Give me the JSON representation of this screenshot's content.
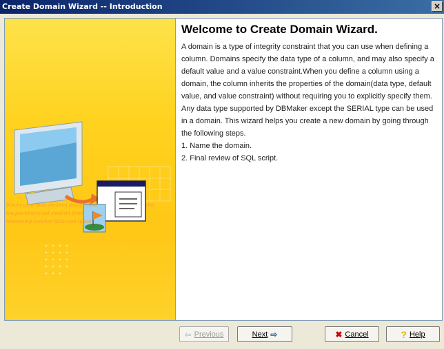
{
  "window": {
    "title": "Create Domain Wizard -- Introduction",
    "close_label": "×"
  },
  "content": {
    "heading": "Welcome to Create Domain Wizard.",
    "paragraph1": "A domain is a type of integrity constraint that you can use when defining a column. Domains specify the data type of a column, and may also specify a default value and a value constraint.When you define a column using a domain, the column inherits the properties of the domain(data type, default value, and value constraint) without requiring you to explicitly specify them.",
    "paragraph2": "Any data type supported by DBMaker except the SERIAL type can be used in a domain. This wizard helps you create a new domain by going through the following steps.",
    "step1": "1. Name the domain.",
    "step2": "2. Final review of SQL script."
  },
  "illustration": {
    "line1": "binary char data decimal double float",
    "line2": "longvarbinary oid smallint time",
    "line3": "timestamp varchar blob clob nclob",
    "word_dec": "dec"
  },
  "buttons": {
    "previous": {
      "label": "Previous",
      "enabled": false
    },
    "next": {
      "label": "Next",
      "enabled": true
    },
    "cancel": {
      "label": "Cancel",
      "enabled": true
    },
    "help": {
      "label": "Help",
      "enabled": true
    }
  },
  "colors": {
    "titlebar_start": "#0a246a",
    "titlebar_end": "#3a6ea5",
    "panel_yellow": "#ffd21e",
    "cancel_icon": "#d40000",
    "help_icon": "#f0c800",
    "arrow_icon": "#3a6ea5"
  }
}
